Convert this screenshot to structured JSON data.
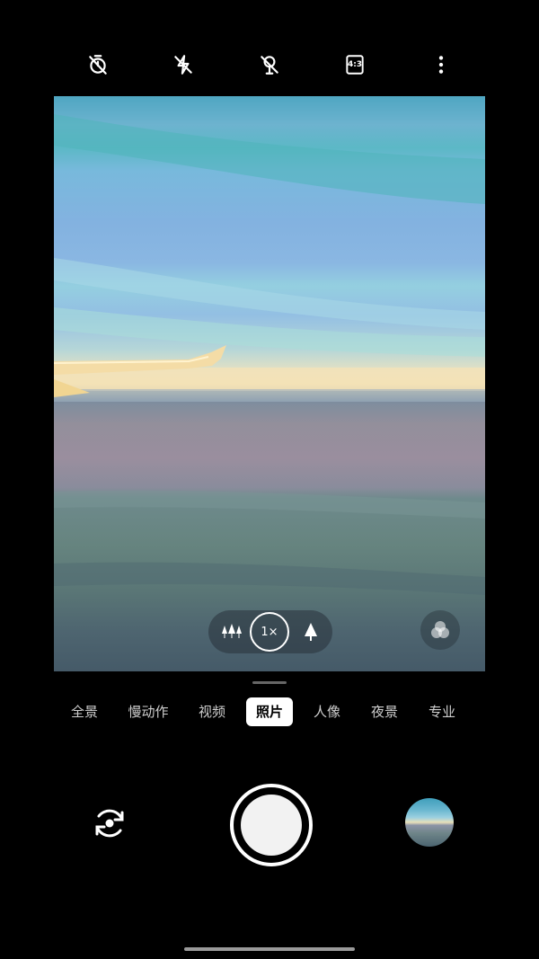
{
  "top_bar": {
    "timer_icon": "timer-off-icon",
    "flash_icon": "flash-off-icon",
    "live_icon": "live-photo-off-icon",
    "aspect_label": "4:3",
    "more_icon": "more-vertical-icon"
  },
  "viewfinder": {
    "zoom_wide_icon": "wide-angle-trees-icon",
    "zoom_label": "1×",
    "zoom_tele_icon": "telephoto-tree-icon",
    "filter_icon": "filter-circles-icon"
  },
  "modes": [
    {
      "label": "全景",
      "active": false
    },
    {
      "label": "慢动作",
      "active": false
    },
    {
      "label": "视频",
      "active": false
    },
    {
      "label": "照片",
      "active": true
    },
    {
      "label": "人像",
      "active": false
    },
    {
      "label": "夜景",
      "active": false
    },
    {
      "label": "专业",
      "active": false
    }
  ],
  "bottom": {
    "switch_icon": "camera-switch-icon",
    "shutter_icon": "shutter-button",
    "gallery_icon": "gallery-thumbnail"
  },
  "colors": {
    "background": "#000000",
    "active_mode_bg": "#ffffff",
    "mode_text": "#cfcfcf"
  }
}
